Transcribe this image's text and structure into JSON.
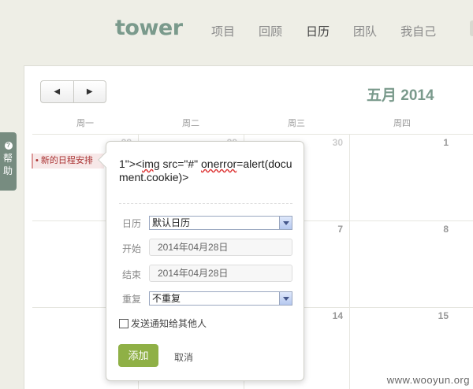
{
  "app": {
    "logo": "tower"
  },
  "nav": [
    {
      "label": "项目",
      "active": false
    },
    {
      "label": "回顾",
      "active": false
    },
    {
      "label": "日历",
      "active": true
    },
    {
      "label": "团队",
      "active": false
    },
    {
      "label": "我自己",
      "active": false
    }
  ],
  "help": {
    "label": "帮助",
    "icon": "question-icon"
  },
  "calendar": {
    "title": "五月 2014",
    "prev_icon": "◀",
    "next_icon": "▶",
    "weekdays": [
      "周一",
      "周二",
      "周三",
      "周四"
    ],
    "rows": [
      [
        "28",
        "29",
        "30",
        "1"
      ],
      [
        "",
        "",
        "7",
        "8"
      ],
      [
        "",
        "",
        "14",
        "15"
      ]
    ]
  },
  "event_chip": {
    "label": "• 新的日程安排"
  },
  "popover": {
    "title_line1": "1\"><",
    "title_img": "img",
    "title_line2": " src=\"#\" ",
    "title_onerror": "onerror",
    "title_line3": "=alert(document.cookie)>",
    "calendar_label": "日历",
    "calendar_value": "默认日历",
    "start_label": "开始",
    "start_value": "2014年04月28日",
    "end_label": "结束",
    "end_value": "2014年04月28日",
    "repeat_label": "重复",
    "repeat_value": "不重复",
    "notify_label": "发送通知给其他人",
    "notify_checked": false,
    "add_label": "添加",
    "cancel_label": "取消"
  },
  "watermark": "www.wooyun.org",
  "colors": {
    "brand": "#7a9a8c",
    "add_button": "#8fb046",
    "background": "#eeeee6"
  }
}
